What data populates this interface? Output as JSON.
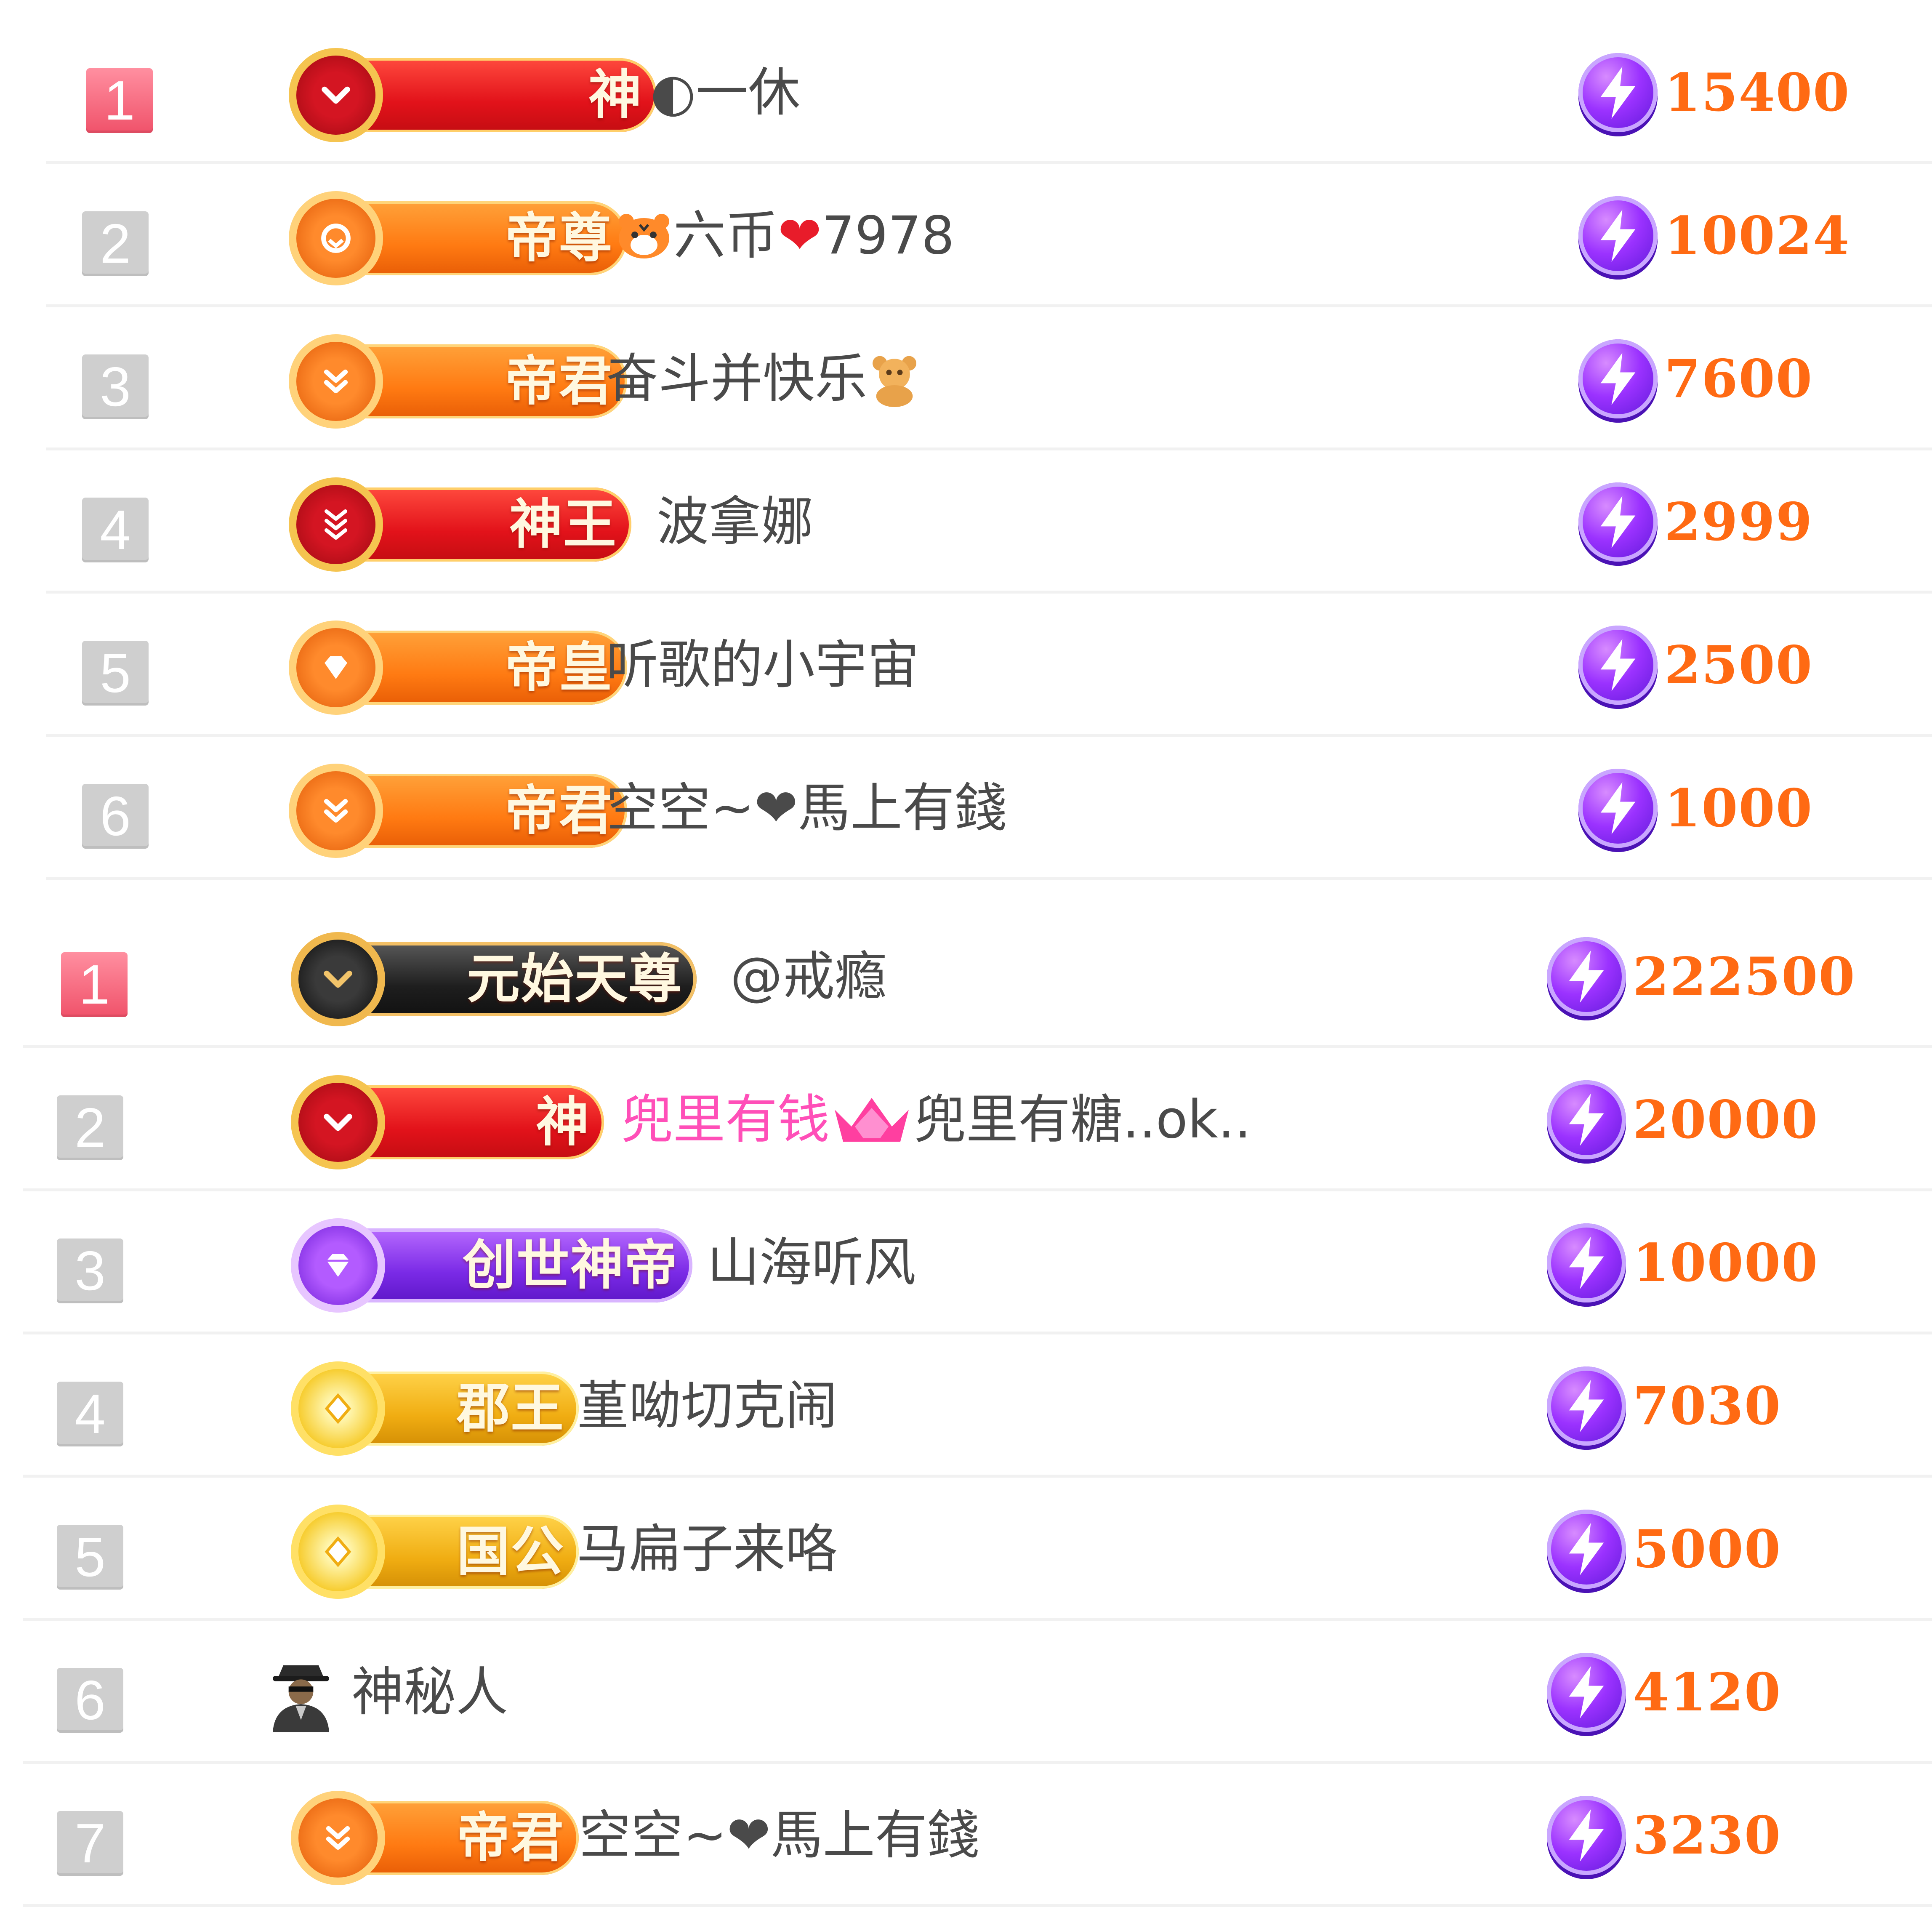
{
  "colors": {
    "score": "#ff6a13",
    "rank_top": "#f0526a",
    "rank_default": "#cfcfcf",
    "name_text": "#4a4a4a",
    "name_pink": "#ff4fb8"
  },
  "sections": [
    {
      "rows": [
        {
          "rank": "1",
          "badge": "神",
          "badge_style": "red",
          "badge_icon": "chevron-down-icon",
          "name": "◐一休",
          "score": "15400"
        },
        {
          "rank": "2",
          "badge": "帝尊",
          "badge_style": "orange",
          "badge_icon": "crest-icon",
          "name_prefix_icon": "tiger-icon",
          "name": "六币",
          "name_suffix_icon": "heart-icon",
          "name_suffix": "7978",
          "score": "10024"
        },
        {
          "rank": "3",
          "badge": "帝君",
          "badge_style": "orange",
          "badge_icon": "double-chevron-icon",
          "name": "奋斗并快乐",
          "name_suffix_icon": "bear-icon",
          "score": "7600"
        },
        {
          "rank": "4",
          "badge": "神王",
          "badge_style": "red",
          "badge_icon": "triple-chevron-icon",
          "name": "波拿娜",
          "score": "2999"
        },
        {
          "rank": "5",
          "badge": "帝皇",
          "badge_style": "orange",
          "badge_icon": "diamond-icon",
          "name": "听歌的小宇宙",
          "score": "2500"
        },
        {
          "rank": "6",
          "badge": "帝君",
          "badge_style": "orange",
          "badge_icon": "double-chevron-icon",
          "name": "空空~❤馬上有錢",
          "score": "1000"
        }
      ]
    },
    {
      "rows": [
        {
          "rank": "1",
          "badge": "元始天尊",
          "badge_style": "black",
          "badge_icon": "chevron-down-icon",
          "name": "@戒瘾",
          "score": "222500"
        },
        {
          "rank": "2",
          "badge": "神",
          "badge_style": "red",
          "badge_icon": "chevron-down-icon",
          "name_pink": "兜里有钱",
          "name_mid_icon": "crown-icon",
          "name": "兜里有糖..ok..",
          "score": "20000"
        },
        {
          "rank": "3",
          "badge": "创世神帝",
          "badge_style": "purple",
          "badge_icon": "gem-icon",
          "name": "山海听风",
          "score": "10000"
        },
        {
          "rank": "4",
          "badge": "郡王",
          "badge_style": "gold",
          "badge_icon": "diamond-icon",
          "name": "堇呦切克闹",
          "score": "7030"
        },
        {
          "rank": "5",
          "badge": "国公",
          "badge_style": "gold",
          "badge_icon": "diamond-icon",
          "name": "马扁子来咯",
          "score": "5000"
        },
        {
          "rank": "6",
          "badge": "",
          "badge_style": "none",
          "badge_icon": "mystery-person-icon",
          "name": "神秘人",
          "score": "4120"
        },
        {
          "rank": "7",
          "badge": "帝君",
          "badge_style": "orange",
          "badge_icon": "double-chevron-icon",
          "name": "空空~❤馬上有錢",
          "score": "3230"
        }
      ]
    }
  ]
}
